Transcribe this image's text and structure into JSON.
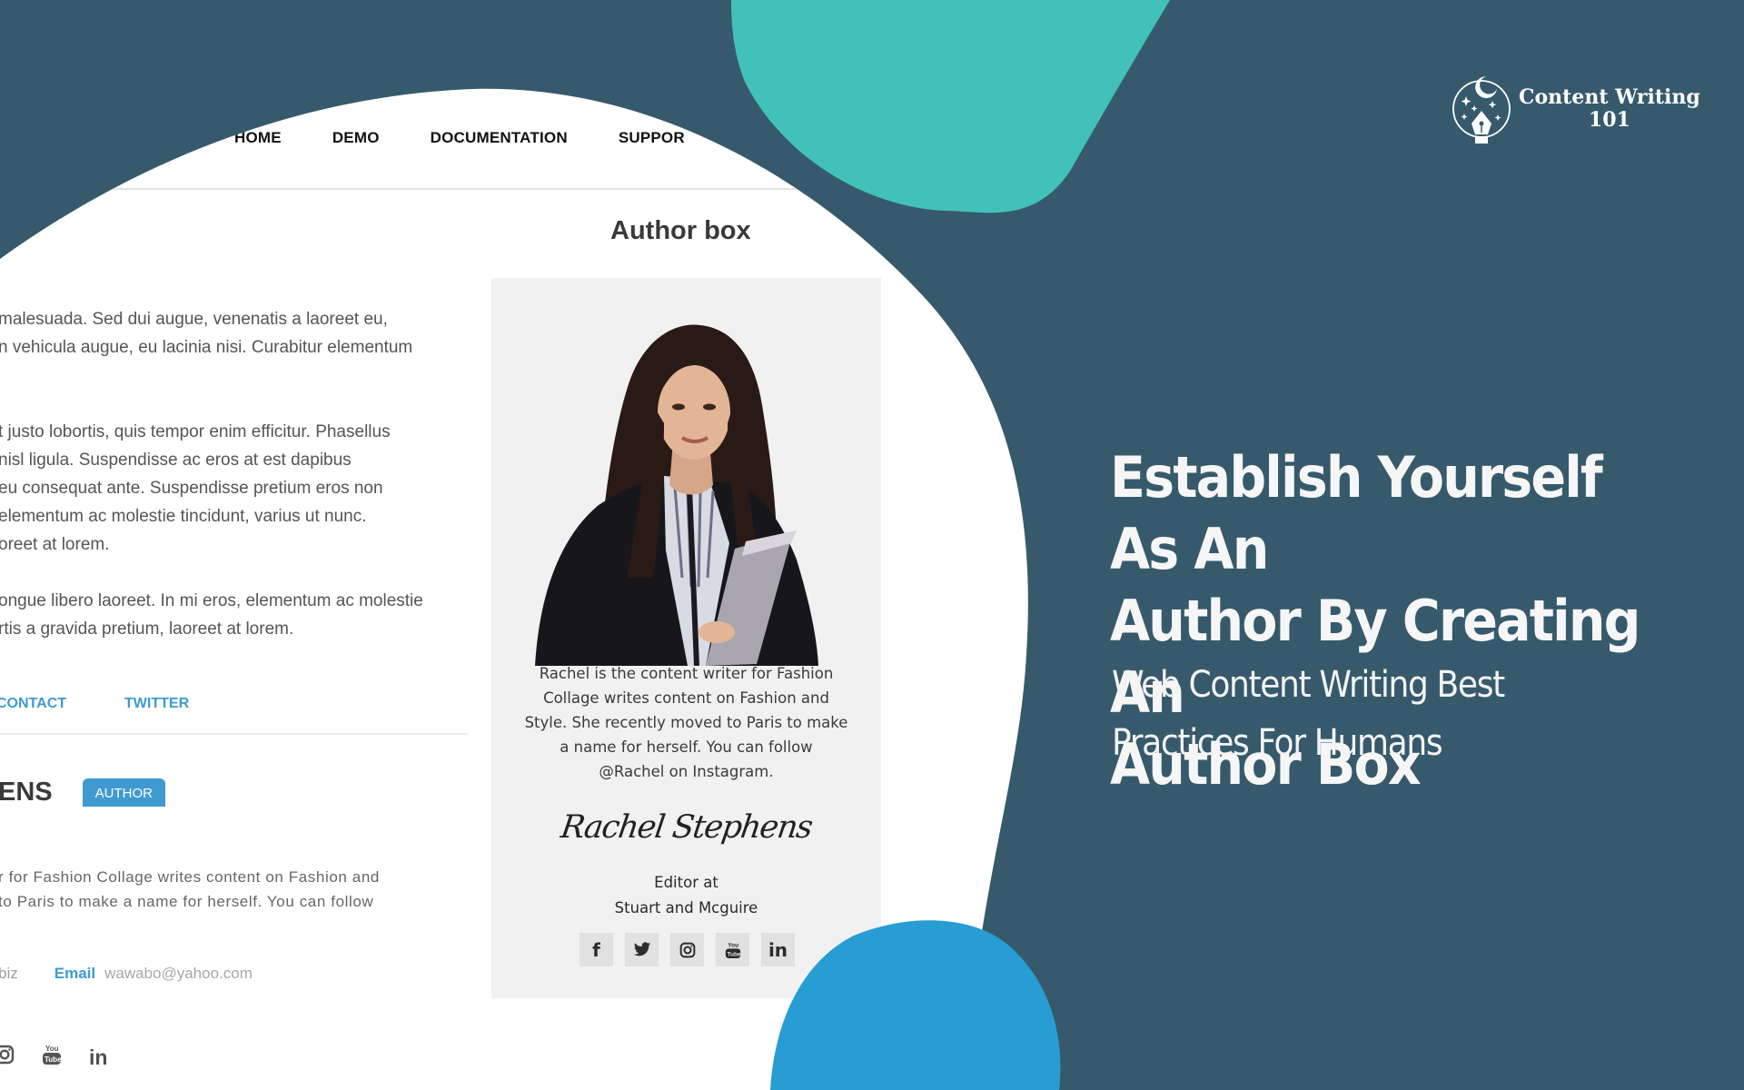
{
  "brand": {
    "logo_icon": "pen-nib-moon-icon",
    "line1": "Content Writing",
    "line2": "101"
  },
  "hero": {
    "headline_lines": [
      "Establish Yourself As An",
      "Author By Creating An",
      "Author Box"
    ],
    "subhead_lines": [
      "Web Content Writing Best",
      "Practices For Humans"
    ]
  },
  "colors": {
    "background": "#365a6c",
    "teal_blob": "#42c1ba",
    "blue_blob": "#289dd3",
    "link_blue": "#3e9bd0",
    "card_bg": "#f1f1f1"
  },
  "site": {
    "nav": [
      "HOME",
      "DEMO",
      "DOCUMENTATION",
      "SUPPOR"
    ],
    "section_title": "Author box",
    "body_paragraphs": [
      [
        "malesuada. Sed dui augue, venenatis a laoreet eu,",
        "n vehicula augue, eu lacinia nisi. Curabitur elementum"
      ],
      [
        "t justo lobortis, quis tempor enim efficitur. Phasellus",
        " nisl ligula. Suspendisse ac eros at est dapibus",
        "eu consequat ante. Suspendisse pretium eros non",
        " elementum ac molestie tincidunt, varius ut nunc.",
        "oreet at lorem."
      ],
      [
        "ongue libero laoreet. In mi eros, elementum ac molestie",
        "rtis a gravida pretium, laoreet at lorem."
      ]
    ],
    "links": [
      "CONTACT",
      "TWITTER"
    ],
    "author_name_fragment": "ENS",
    "author_badge": "AUTHOR",
    "bio_lines": [
      "r for Fashion Collage writes content on Fashion and",
      "to Paris to make a name for herself. You can follow"
    ],
    "website_fragment": "biz",
    "email_label": "Email",
    "email_value": "wawabo@yahoo.com",
    "social_icons": [
      "instagram-icon",
      "youtube-icon",
      "linkedin-icon"
    ]
  },
  "card": {
    "photo_alt": "Rachel Stephens portrait",
    "bio_lines": [
      "Rachel is the content writer for Fashion",
      "Collage writes content on Fashion and",
      "Style. She recently moved to Paris to make",
      "a name for herself. You can follow",
      "@Rachel on Instagram."
    ],
    "signature": "Rachel Stephens",
    "role_line1": "Editor at",
    "role_line2": "Stuart and Mcguire",
    "social": [
      {
        "icon": "facebook-icon",
        "glyph": "f"
      },
      {
        "icon": "twitter-icon",
        "glyph": "🐦"
      },
      {
        "icon": "instagram-icon",
        "glyph": "◎"
      },
      {
        "icon": "youtube-icon",
        "glyph": "▶"
      },
      {
        "icon": "linkedin-icon",
        "glyph": "in"
      }
    ]
  }
}
